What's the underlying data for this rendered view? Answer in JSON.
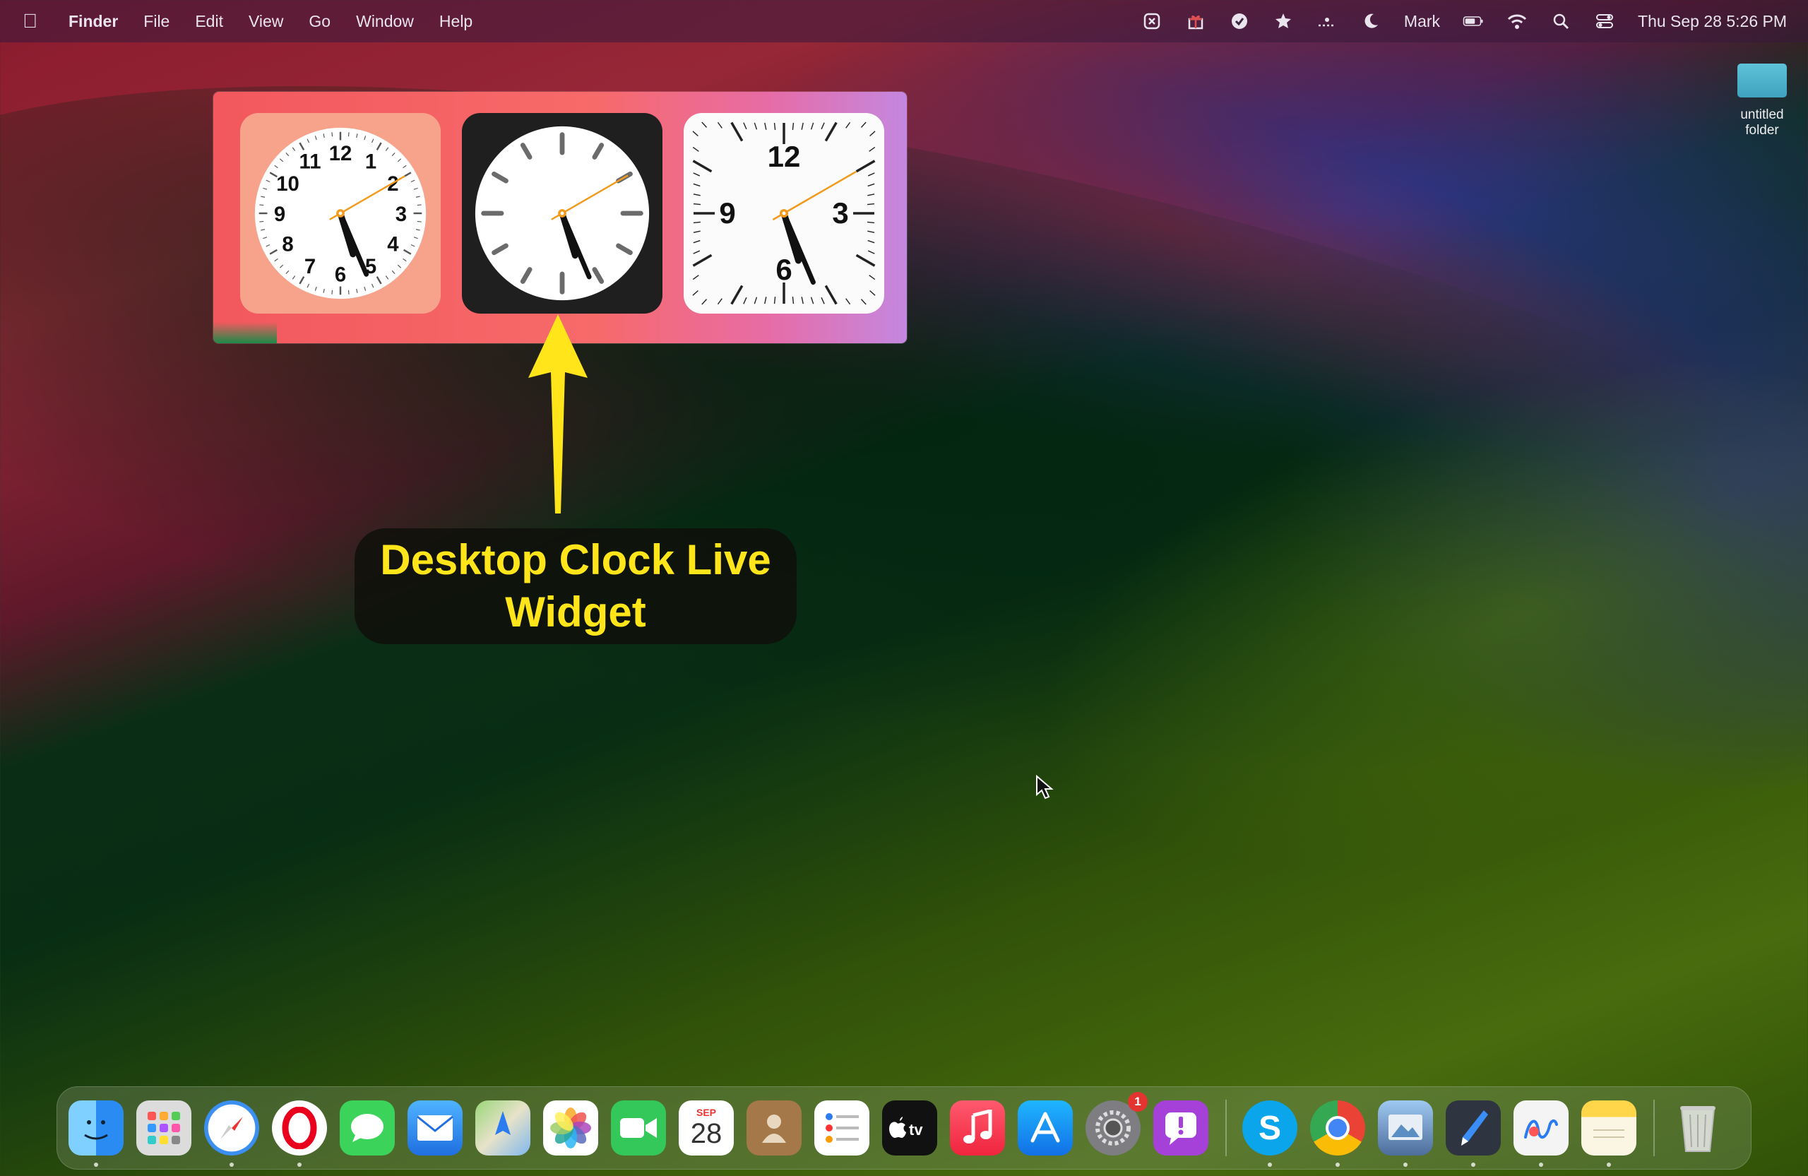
{
  "menubar": {
    "app_name": "Finder",
    "menus": [
      "File",
      "Edit",
      "View",
      "Go",
      "Window",
      "Help"
    ],
    "user": "Mark",
    "datetime": "Thu Sep 28  5:26 PM"
  },
  "desktop": {
    "folder_label": "untitled folder"
  },
  "widgets": {
    "time": {
      "hour": 5,
      "minute": 26,
      "second": 10
    },
    "clock_styles": [
      "pink-numerals",
      "dark-ticks",
      "white-quarter-numerals"
    ]
  },
  "annotation": {
    "caption_line1": "Desktop Clock Live",
    "caption_line2": "Widget",
    "arrow_color": "#ffe51a"
  },
  "dock": {
    "calendar_month": "SEP",
    "calendar_day": "28",
    "settings_badge": "1",
    "apps": [
      "Finder",
      "Launchpad",
      "Safari",
      "Opera",
      "Messages",
      "Mail",
      "Maps",
      "Photos",
      "FaceTime",
      "Calendar",
      "Contacts",
      "Reminders",
      "Apple TV",
      "Music",
      "App Store",
      "System Settings",
      "Feedback Assistant",
      "Skype",
      "Chrome",
      "Preview",
      "Pages",
      "Freeform",
      "Notes",
      "Trash"
    ]
  }
}
